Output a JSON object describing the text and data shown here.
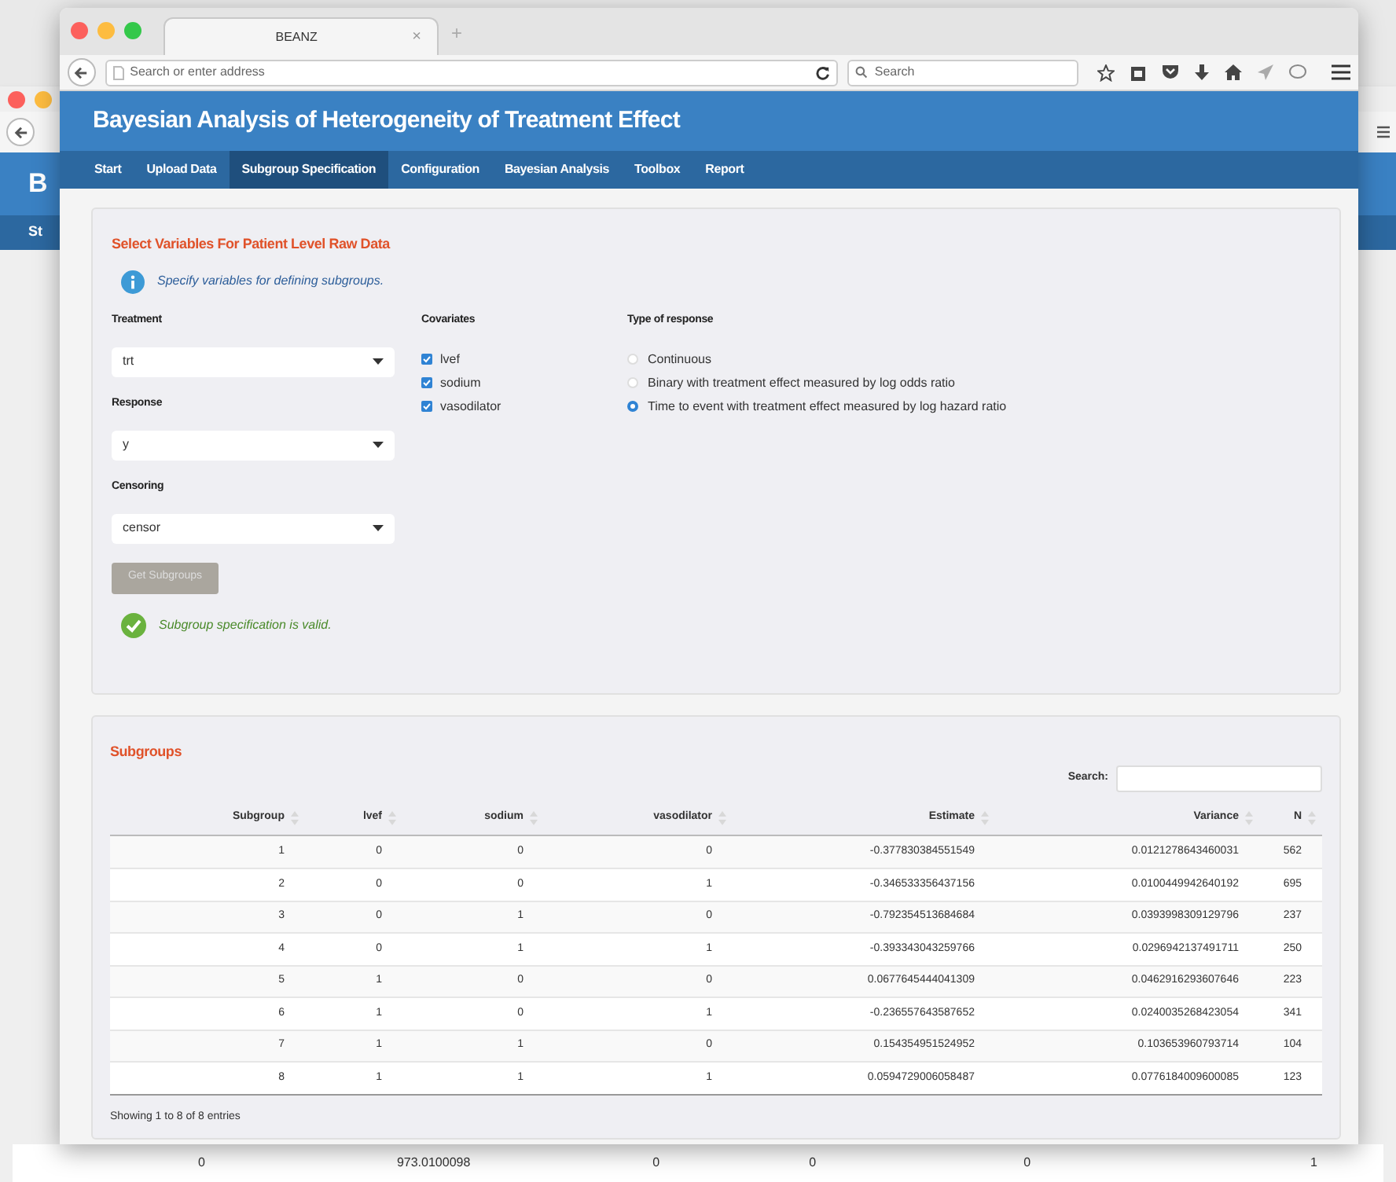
{
  "background_window": {
    "title_fragment": "B",
    "nav_fragment": "St",
    "bottom_row": [
      "0",
      "973.0100098",
      "0",
      "0",
      "0",
      "1"
    ]
  },
  "browser": {
    "tab_title": "BEANZ",
    "tab_close": "×",
    "new_tab": "+",
    "address_placeholder": "Search or enter address",
    "search_placeholder": "Search"
  },
  "app": {
    "title": "Bayesian Analysis of Heterogeneity of Treatment Effect",
    "nav": [
      {
        "label": "Start",
        "selected": false
      },
      {
        "label": "Upload Data",
        "selected": false
      },
      {
        "label": "Subgroup Specification",
        "selected": true
      },
      {
        "label": "Configuration",
        "selected": false
      },
      {
        "label": "Bayesian Analysis",
        "selected": false
      },
      {
        "label": "Toolbox",
        "selected": false
      },
      {
        "label": "Report",
        "selected": false
      }
    ]
  },
  "variables_panel": {
    "heading": "Select Variables For Patient Level Raw Data",
    "info": "Specify variables for defining subgroups.",
    "selects": [
      {
        "label": "Treatment",
        "value": "trt"
      },
      {
        "label": "Response",
        "value": "y"
      },
      {
        "label": "Censoring",
        "value": "censor"
      }
    ],
    "covariates": {
      "label": "Covariates",
      "items": [
        {
          "label": "lvef",
          "checked": true
        },
        {
          "label": "sodium",
          "checked": true
        },
        {
          "label": "vasodilator",
          "checked": true
        }
      ]
    },
    "response_type": {
      "label": "Type of response",
      "options": [
        {
          "label": "Continuous",
          "selected": false
        },
        {
          "label": "Binary with treatment effect measured by log odds ratio",
          "selected": false
        },
        {
          "label": "Time to event with treatment effect measured by log hazard ratio",
          "selected": true
        }
      ]
    },
    "button": {
      "label": "Get Subgroups",
      "disabled": true
    },
    "status": "Subgroup specification is valid."
  },
  "subgroups_panel": {
    "heading": "Subgroups",
    "search_label": "Search:",
    "columns": [
      "Subgroup",
      "lvef",
      "sodium",
      "vasodilator",
      "Estimate",
      "Variance",
      "N"
    ],
    "rows": [
      [
        "1",
        "0",
        "0",
        "0",
        "-0.377830384551549",
        "0.0121278643460031",
        "562"
      ],
      [
        "2",
        "0",
        "0",
        "1",
        "-0.346533356437156",
        "0.0100449942640192",
        "695"
      ],
      [
        "3",
        "0",
        "1",
        "0",
        "-0.792354513684684",
        "0.0393998309129796",
        "237"
      ],
      [
        "4",
        "0",
        "1",
        "1",
        "-0.393343043259766",
        "0.0296942137491711",
        "250"
      ],
      [
        "5",
        "1",
        "0",
        "0",
        "0.0677645444041309",
        "0.0462916293607646",
        "223"
      ],
      [
        "6",
        "1",
        "0",
        "1",
        "-0.236557643587652",
        "0.0240035268423054",
        "341"
      ],
      [
        "7",
        "1",
        "1",
        "0",
        "0.154354951524952",
        "0.103653960793714",
        "104"
      ],
      [
        "8",
        "1",
        "1",
        "1",
        "0.0594729006058487",
        "0.0776184009600085",
        "123"
      ]
    ],
    "footer": "Showing 1 to 8 of 8 entries"
  }
}
